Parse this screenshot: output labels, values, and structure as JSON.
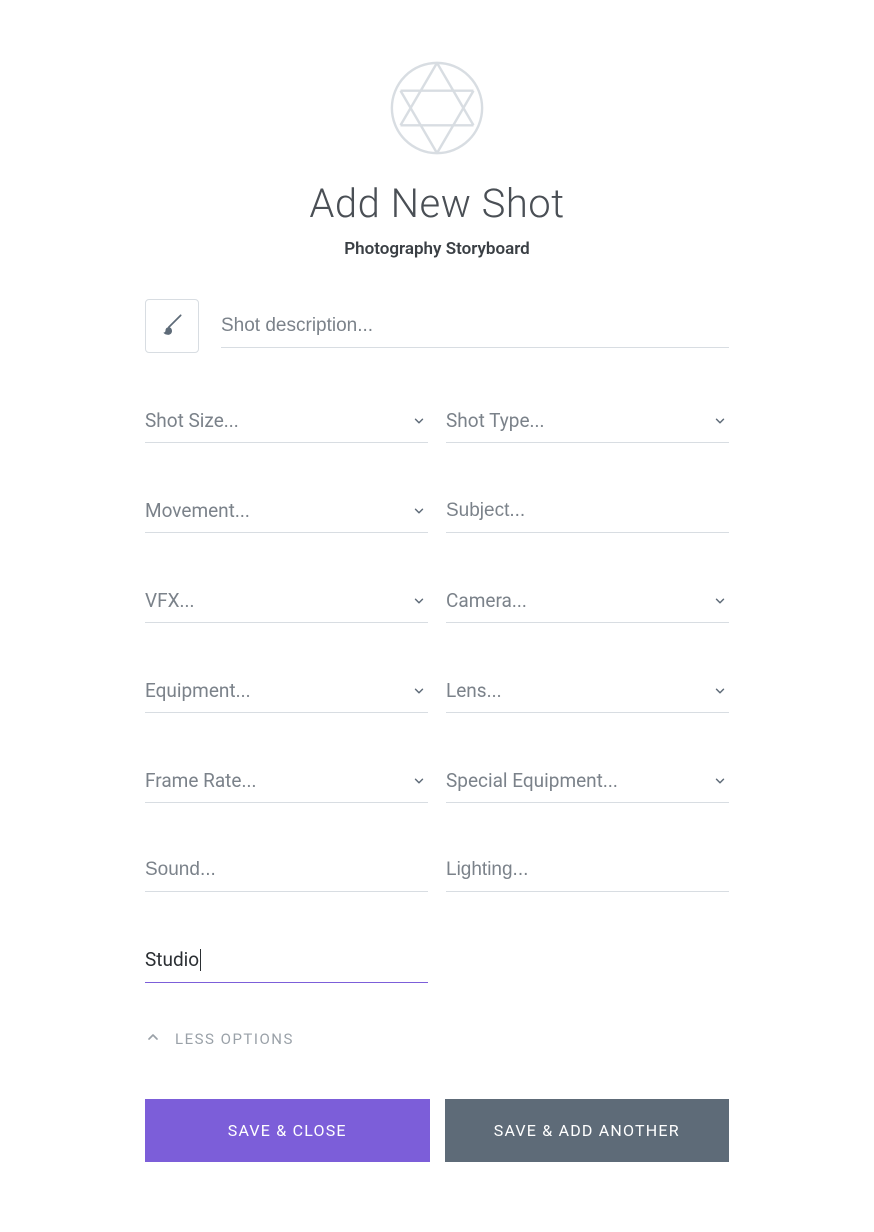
{
  "header": {
    "title": "Add New Shot",
    "subtitle": "Photography Storyboard"
  },
  "description": {
    "placeholder": "Shot description...",
    "value": ""
  },
  "fields": {
    "shot_size": {
      "placeholder": "Shot Size..."
    },
    "shot_type": {
      "placeholder": "Shot Type..."
    },
    "movement": {
      "placeholder": "Movement..."
    },
    "subject": {
      "placeholder": "Subject..."
    },
    "vfx": {
      "placeholder": "VFX..."
    },
    "camera": {
      "placeholder": "Camera..."
    },
    "equipment": {
      "placeholder": "Equipment..."
    },
    "lens": {
      "placeholder": "Lens..."
    },
    "frame_rate": {
      "placeholder": "Frame Rate..."
    },
    "special_equipment": {
      "placeholder": "Special Equipment..."
    },
    "sound": {
      "placeholder": "Sound..."
    },
    "lighting": {
      "placeholder": "Lighting..."
    },
    "location": {
      "value": "Studio"
    }
  },
  "toggle": {
    "less_options": "LESS OPTIONS"
  },
  "buttons": {
    "save_close": "SAVE & CLOSE",
    "save_add": "SAVE & ADD ANOTHER"
  },
  "colors": {
    "accent": "#7c5ed9",
    "secondary": "#5e6b78",
    "border": "#d8dde2",
    "placeholder": "#7b828a"
  }
}
